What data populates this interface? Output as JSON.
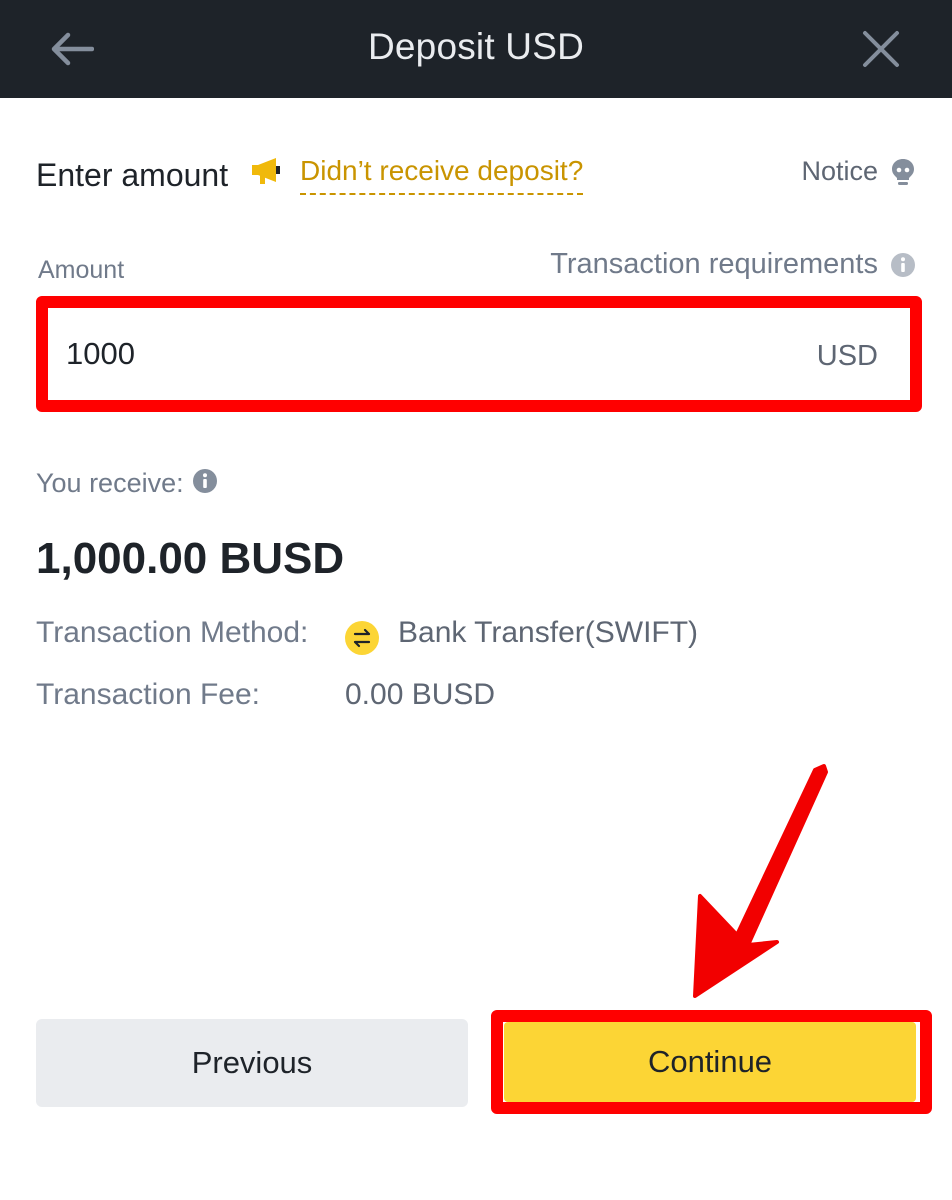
{
  "header": {
    "title": "Deposit USD",
    "back_icon": "arrow-left-icon",
    "close_icon": "close-icon"
  },
  "enter_amount": {
    "title": "Enter amount",
    "megaphone_icon": "megaphone-icon",
    "help_link": "Didn’t receive deposit?",
    "notice_label": "Notice",
    "notice_icon": "lightbulb-icon"
  },
  "amount": {
    "label": "Amount",
    "requirements_label": "Transaction requirements",
    "requirements_icon": "info-icon",
    "value": "1000",
    "currency": "USD"
  },
  "receive": {
    "label": "You receive:",
    "info_icon": "info-icon",
    "amount": "1,000.00 BUSD"
  },
  "details": {
    "method_label": "Transaction Method:",
    "method_icon": "exchange-arrows-icon",
    "method_value": "Bank Transfer(SWIFT)",
    "fee_label": "Transaction Fee:",
    "fee_value": "0.00 BUSD"
  },
  "buttons": {
    "previous": "Previous",
    "continue": "Continue"
  },
  "colors": {
    "header_bg": "#1e2329",
    "accent_yellow": "#fcd535",
    "link_gold": "#c99400",
    "highlight_red": "#ff0000",
    "secondary_button": "#eaecef"
  }
}
